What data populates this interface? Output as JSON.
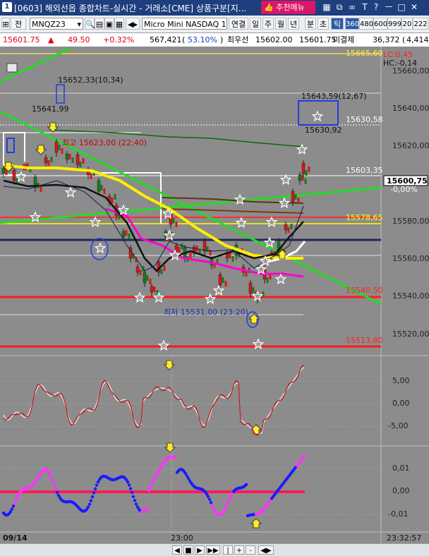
{
  "window": {
    "index": "1",
    "title": "[0603] 해외선옵 종합차트-실시간 - 거래소[CME] 상품구분[지...",
    "recommend_label": "추천메뉴",
    "icons": [
      "grid-icon",
      "copy-icon",
      "link-icon",
      "help-icon",
      "pin-icon",
      "minimize-icon",
      "maximize-icon",
      "close-icon"
    ]
  },
  "toolbar": {
    "prev_label": "전",
    "symbol": "MNQZ23",
    "product_name": "Micro Mini NASDAQ 10",
    "link_label": "연결",
    "periods": [
      "일",
      "주",
      "월",
      "년",
      "분",
      "초",
      "틱"
    ],
    "selected_period": "틱",
    "intervals": [
      "360",
      "480",
      "600",
      "999",
      "20",
      "222"
    ],
    "selected_interval": "360"
  },
  "quote": {
    "price": "15601.75",
    "change": "49.50",
    "change_pct": "+0.32%",
    "volume": "567,421",
    "volume_ratio": "53.10%",
    "best_bid_label": "최우선",
    "best_bid": "15602.00",
    "best_ask": "15601.75",
    "open_interest_label": "미결제",
    "open_interest": "36,372",
    "extra": "4,414"
  },
  "chart_data": {
    "type": "candlestick",
    "price_axis": {
      "ticks": [
        "15660,00",
        "15640,00",
        "15620,00",
        "15600,00",
        "15580,00",
        "15560,00",
        "15540,00",
        "15520,00"
      ],
      "current_price_tag": "15600,75",
      "current_change_tag": "-0,00%",
      "lc_label": "LC:0,45",
      "hc_label": "HC:-0,14"
    },
    "horizontal_levels": [
      {
        "label": "15665,60",
        "color": "#ffee44"
      },
      {
        "label": "15630,58",
        "color": "#ffffff"
      },
      {
        "label": "15603,35",
        "color": "#ffffff"
      },
      {
        "label": "15578,65",
        "color": "#ffff00"
      },
      {
        "label": "15540,50",
        "color": "#ff2020"
      },
      {
        "label": "15513,80",
        "color": "#ff2020"
      }
    ],
    "annotations": [
      {
        "label": "15652,33(10,34)"
      },
      {
        "label": "15641,99"
      },
      {
        "label": "15643,59(12,67)"
      },
      {
        "label": "15630,92"
      },
      {
        "label": "최고 15623,00 (22:40)"
      },
      {
        "label": "최저 15531,00 (23:20)"
      }
    ],
    "oscillator1": {
      "ticks": [
        "5,00",
        "0,00",
        "-5,00"
      ]
    },
    "oscillator2": {
      "ticks": [
        "0,01",
        "0,00",
        "-0,01"
      ]
    },
    "time_axis": {
      "labels": [
        "09/14",
        "23:00"
      ],
      "clock": "23:32:57"
    }
  },
  "bottom_controls": [
    "◀",
    "■",
    "▶",
    "▶▶",
    "|",
    "+",
    "-",
    "◀▶"
  ]
}
